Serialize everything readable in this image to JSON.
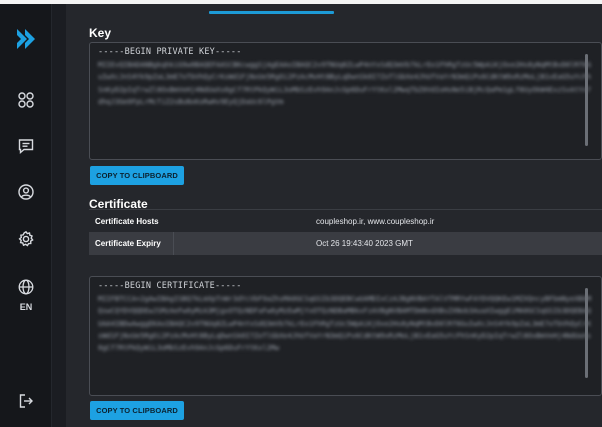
{
  "sidebar": {
    "language_label": "EN"
  },
  "key_section": {
    "title": "Key",
    "pem_header": "-----BEGIN PRIVATE KEY-----",
    "pem_body": "MIIEvQIBADANBgkqhkiG9w0BAQEFAASCBKcwggSjAgEAAoIBAQC2v9TNUq8ZLwP4nYxSdQ3mVb7kLrEo1FhRgTzUc5WpAiKjOxe2Hs8yNqMtBvD0lRf6GuIwXcJnS4Yk9pZaL3mE7oTbVhQyCrKsWd1FjNxUe5RgOi2PzAcMvHt8ByLqDwnSk0I7ZoTlGbXe4JhUfVaYrN3mQiPs6CdKtW9xRzMoLjB1vEaG5uYcFhSnKyD2pIqTrwZl8OxBmVeHj4NdUaXs0gCf7RtPkQyWiL3oMbSzEvh9AnJcGp6DuFrYtKxl2MwqTbZ0VdIoHsNe5iBjRcQaPm1gLf8UyOkW4ExzSvAtYn7dhqJ3Ge0FpLrMcTiZ2sBuNxKoRwHv9EyQjDaUc6lPgVm",
    "copy_button_label": "COPY TO CLIPBOARD"
  },
  "certificate_section": {
    "title": "Certificate",
    "rows": [
      {
        "label": "Certificate Hosts",
        "value": "coupleshop.ir, www.coupleshop.ir"
      },
      {
        "label": "Certificate Expiry",
        "value": "Oct 26 19:43:40 2023 GMT"
      }
    ],
    "pem_header": "-----BEGIN CERTIFICATE-----",
    "pem_body": "MIIFBTCCA+2gAwIBAgISBQ7kLmXpTnWr3dYcVbF9aZhsMA0GCSqGSIb3DQEBCwUAMDIxCzAJBgNVBAYTAlVTMRYwFAYDVQQKEw1MZXQncyBFbmNyeXB0MQswCQYDVQQDEwJSMzAeFw0yMzA3MjgxOTQzNDFaFw0yMzEwMjYxOTQzNDBaMBkxFzAVBgNVBAMTDmNvdXBsZXNob3AuaXIwggEiMA0GCSqGSIb3DQEBAQUAA4IBDwAwggEKAoIBAQC2v9TNUq8ZLwP4nYxSdQ3mVb7kLrEo1FhRgTzUc5WpAiKjOxe2Hs8yNqMtBvD0lRf6GuIwXcJnS4Yk9pZaL3mE7oTbVhQyCrKsWd1FjNxUe5RgOi2PzAcMvHt8ByLqDwnSk0I7ZoTlGbXe4JhUfVaYrN3mQiPs6CdKtW9xRzMoLjB1vEaG5uYcFhSnKyD2pIqTrwZl8OxBmVeHj4NdUaXs0gCf7RtPkQyWiL3oMbSzEvh9AnJcGp6DuFrYtKxl2Mw",
    "copy_button_label": "COPY TO CLIPBOARD"
  },
  "colors": {
    "accent": "#1da1e2",
    "panel": "#25272c",
    "sidebar": "#15171b"
  }
}
